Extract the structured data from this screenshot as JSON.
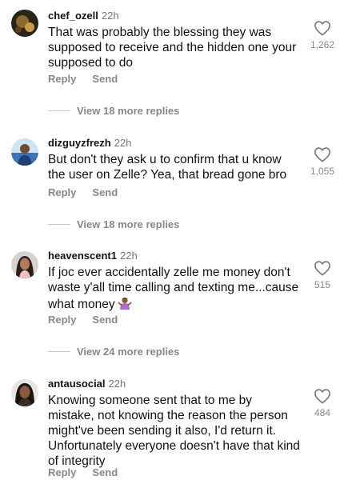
{
  "comments": [
    {
      "username": "chef_ozell",
      "time": "22h",
      "text": "That was probably the blessing they was supposed to receive and the hidden one your supposed to do",
      "likes": "1,262",
      "reply_label": "Reply",
      "send_label": "Send",
      "view_replies": "View 18 more replies",
      "avatar_icon": "dark-food-photo-avatar"
    },
    {
      "username": "dizguyzfrezh",
      "time": "22h",
      "text": "But don't they ask u to confirm that u know the user on Zelle? Yea, that bread gone bro",
      "likes": "1,055",
      "reply_label": "Reply",
      "send_label": "Send",
      "view_replies": "View 18 more replies",
      "avatar_icon": "blue-figure-avatar"
    },
    {
      "username": "heavenscent1",
      "time": "22h",
      "text": "If joc ever accidentally zelle me money don't waste y'all time calling and texting me...cause what money",
      "emoji": "person-shrugging-emoji",
      "likes": "515",
      "reply_label": "Reply",
      "send_label": "Send",
      "view_replies": "View 24 more replies",
      "avatar_icon": "woman-portrait-avatar"
    },
    {
      "username": "antausocial",
      "time": "22h",
      "text": "Knowing someone sent that to me by mistake, not knowing the reason the person might've been sending it also, I'd return it. Unfortunately everyone doesn't have that kind of integrity",
      "likes": "484",
      "reply_label": "Reply",
      "send_label": "Send",
      "avatar_icon": "woman-dark-hair-avatar"
    }
  ]
}
